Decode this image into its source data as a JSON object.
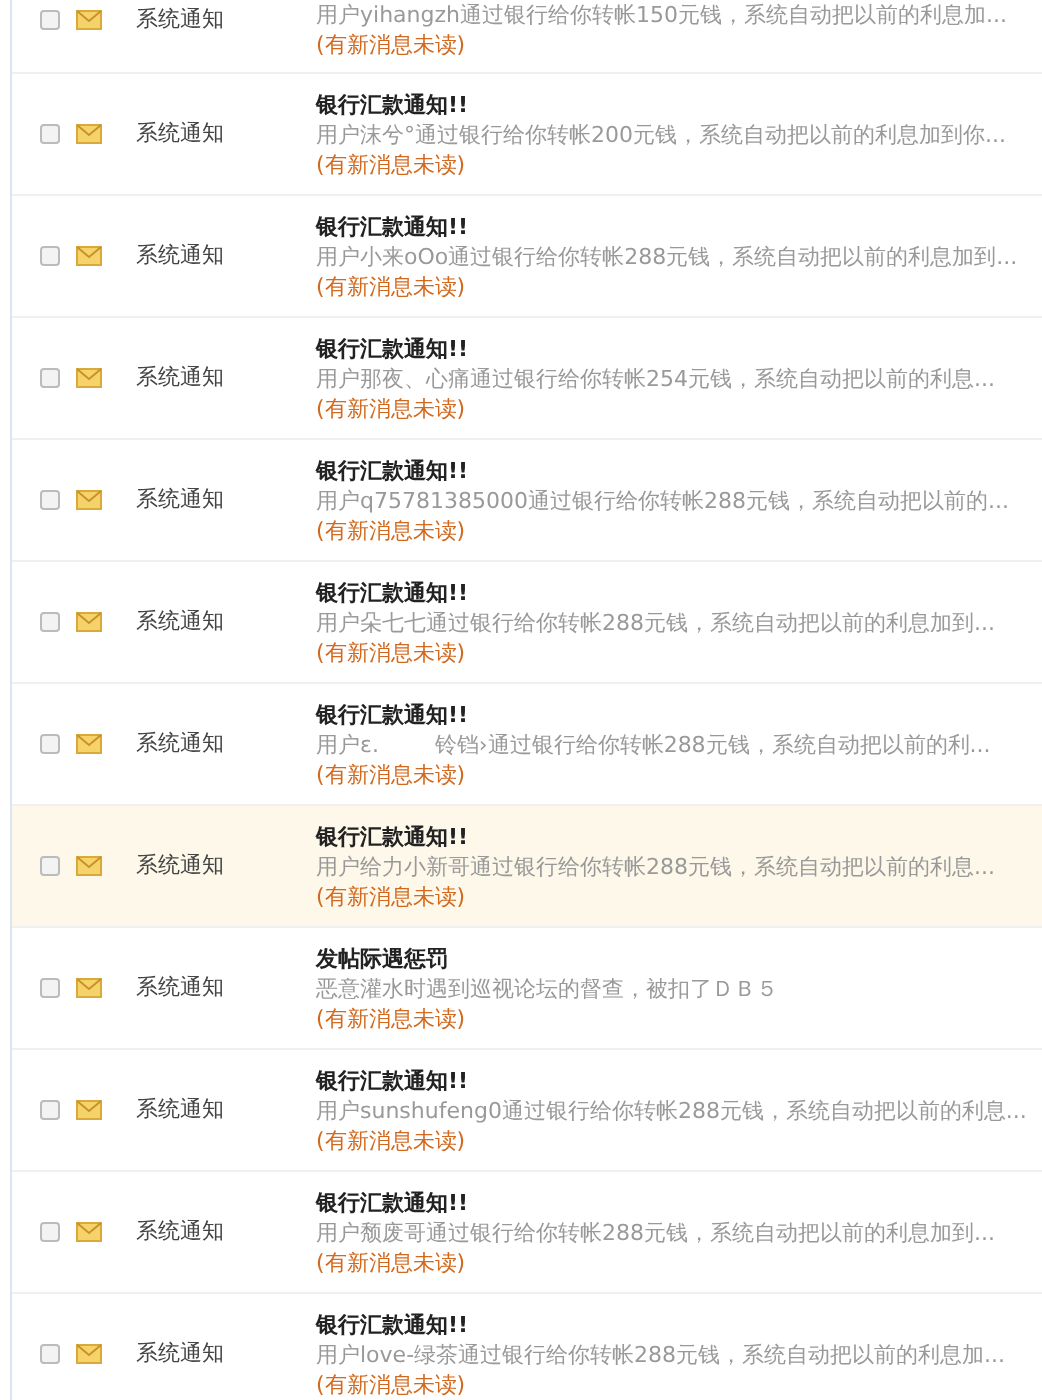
{
  "messages": [
    {
      "checked": false,
      "unread": true,
      "highlighted": false,
      "sender": "系统通知",
      "preview": "用户yihangzh通过银行给你转帐150元钱，系统自动把以前的利息加...",
      "status": "(有新消息未读)"
    },
    {
      "checked": false,
      "unread": true,
      "highlighted": false,
      "sender": "系统通知",
      "title": "银行汇款通知!!",
      "preview": "用户沫兮°通过银行给你转帐200元钱，系统自动把以前的利息加到你...",
      "status": "(有新消息未读)"
    },
    {
      "checked": false,
      "unread": true,
      "highlighted": false,
      "sender": "系统通知",
      "title": "银行汇款通知!!",
      "preview": "用户小来oOo通过银行给你转帐288元钱，系统自动把以前的利息加到...",
      "status": "(有新消息未读)"
    },
    {
      "checked": false,
      "unread": true,
      "highlighted": false,
      "sender": "系统通知",
      "title": "银行汇款通知!!",
      "preview": "用户那夜、心痛通过银行给你转帐254元钱，系统自动把以前的利息...",
      "status": "(有新消息未读)"
    },
    {
      "checked": false,
      "unread": true,
      "highlighted": false,
      "sender": "系统通知",
      "title": "银行汇款通知!!",
      "preview": "用户q75781385000通过银行给你转帐288元钱，系统自动把以前的...",
      "status": "(有新消息未读)"
    },
    {
      "checked": false,
      "unread": true,
      "highlighted": false,
      "sender": "系统通知",
      "title": "银行汇款通知!!",
      "preview": "用户朵七七通过银行给你转帐288元钱，系统自动把以前的利息加到...",
      "status": "(有新消息未读)"
    },
    {
      "checked": false,
      "unread": true,
      "highlighted": false,
      "sender": "系统通知",
      "title": "银行汇款通知!!",
      "preview": "用户ε.        铃铛›通过银行给你转帐288元钱，系统自动把以前的利...",
      "status": "(有新消息未读)"
    },
    {
      "checked": false,
      "unread": true,
      "highlighted": true,
      "sender": "系统通知",
      "title": "银行汇款通知!!",
      "preview": "用户给力小新哥通过银行给你转帐288元钱，系统自动把以前的利息...",
      "status": "(有新消息未读)"
    },
    {
      "checked": false,
      "unread": true,
      "highlighted": false,
      "sender": "系统通知",
      "title": "发帖际遇惩罚",
      "preview": "恶意灌水时遇到巡视论坛的督查，被扣了ＤＢ５",
      "status": "(有新消息未读)"
    },
    {
      "checked": false,
      "unread": true,
      "highlighted": false,
      "sender": "系统通知",
      "title": "银行汇款通知!!",
      "preview": "用户sunshufeng0通过银行给你转帐288元钱，系统自动把以前的利息...",
      "status": "(有新消息未读)"
    },
    {
      "checked": false,
      "unread": true,
      "highlighted": false,
      "sender": "系统通知",
      "title": "银行汇款通知!!",
      "preview": "用户颓废哥通过银行给你转帐288元钱，系统自动把以前的利息加到...",
      "status": "(有新消息未读)"
    },
    {
      "checked": false,
      "unread": true,
      "highlighted": false,
      "sender": "系统通知",
      "title": "银行汇款通知!!",
      "preview": "用户love-绿茶通过银行给你转帐288元钱，系统自动把以前的利息加...",
      "status": "(有新消息未读)"
    }
  ]
}
